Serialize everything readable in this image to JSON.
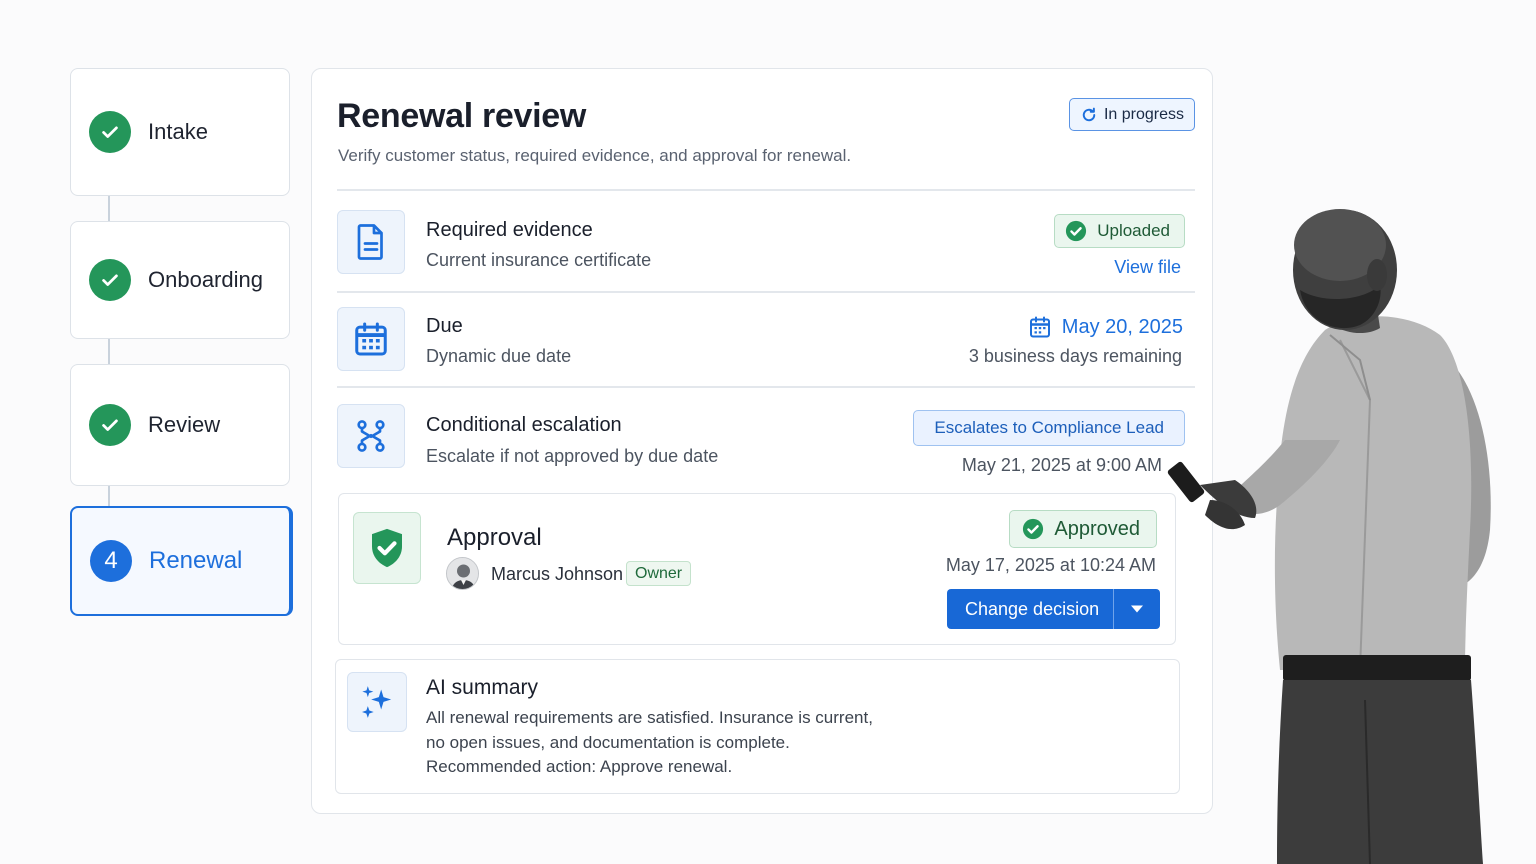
{
  "stepper": {
    "steps": [
      {
        "label": "Intake",
        "state": "complete"
      },
      {
        "label": "Onboarding",
        "state": "complete"
      },
      {
        "label": "Review",
        "state": "complete"
      },
      {
        "label": "Renewal",
        "number": "4",
        "state": "current"
      }
    ]
  },
  "header": {
    "title": "Renewal review",
    "subtitle": "Verify customer status, required evidence, and approval for renewal.",
    "status": "In progress"
  },
  "evidence": {
    "title": "Required evidence",
    "subtitle": "Current insurance certificate",
    "status": "Uploaded",
    "link": "View file"
  },
  "due": {
    "title": "Due",
    "subtitle": "Dynamic due date",
    "date": "May 20, 2025",
    "remaining": "3 business days remaining"
  },
  "escalation": {
    "title": "Conditional escalation",
    "subtitle": "Escalate if not approved by due date",
    "target": "Escalates to Compliance Lead",
    "time": "May 21, 2025 at 9:00 AM"
  },
  "approval": {
    "title": "Approval",
    "person": "Marcus Johnson",
    "role": "Owner",
    "status": "Approved",
    "time": "May 17, 2025 at 10:24 AM",
    "button": "Change decision"
  },
  "ai_summary": {
    "title": "AI summary",
    "lines": [
      "All renewal requirements are satisfied. Insurance is current,",
      "no open issues, and documentation is complete.",
      "Recommended action: Approve renewal."
    ]
  },
  "colors": {
    "accent": "#1d6fdc",
    "success": "#24965a",
    "border": "#e1e5ea"
  }
}
